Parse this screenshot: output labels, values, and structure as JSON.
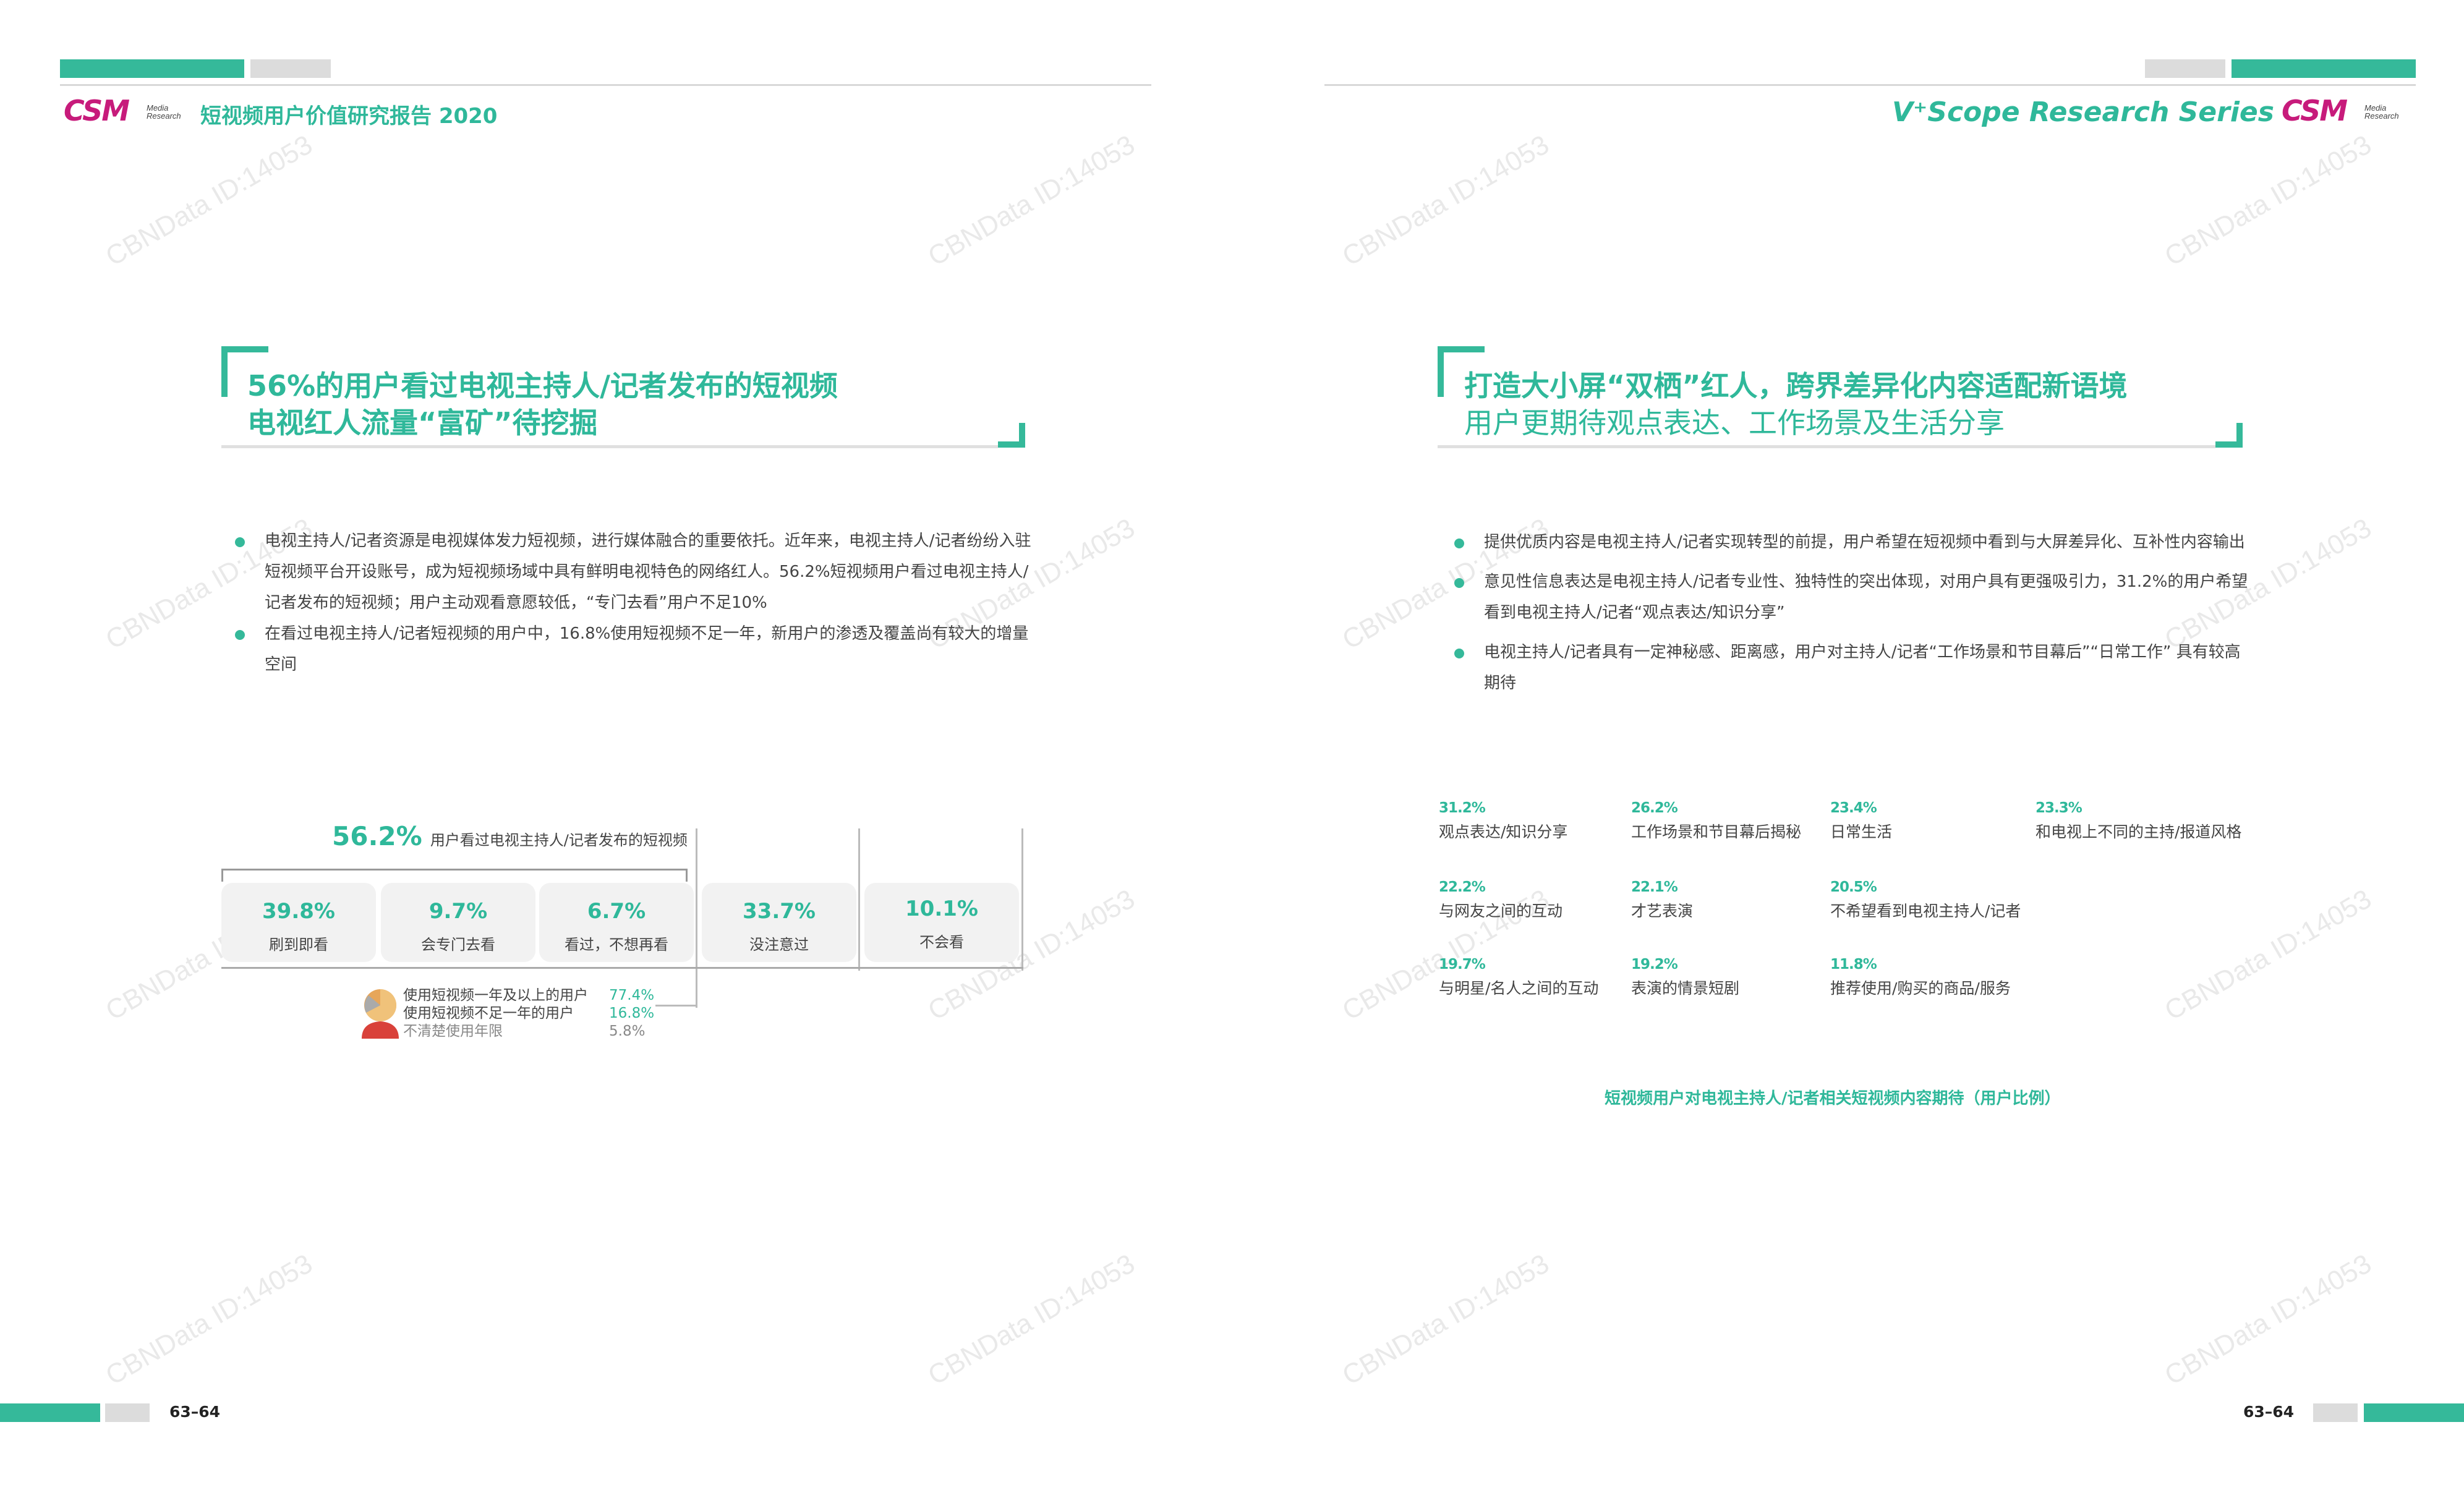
{
  "header": {
    "report_title": "短视频用户价值研究报告 2020",
    "brand": "CSM",
    "brand_sub_1": "Media",
    "brand_sub_2": "Research",
    "series_title": "V⁺Scope Research Series"
  },
  "watermark": "CBNData ID:14053",
  "left": {
    "title_line1": "56%的用户看过电视主持人/记者发布的短视频",
    "title_line2": "电视红人流量“富矿”待挖掘",
    "bullets": [
      "电视主持人/记者资源是电视媒体发力短视频，进行媒体融合的重要依托。近年来，电视主持人/记者纷纷入驻短视频平台开设账号，成为短视频场域中具有鲜明电视特色的网络红人。56.2%短视频用户看过电视主持人/记者发布的短视频；用户主动观看意愿较低，“专门去看”用户不足10%",
      "在看过电视主持人/记者短视频的用户中，16.8%使用短视频不足一年，新用户的渗透及覆盖尚有较大的增量空间"
    ],
    "watched_pct": "56.2%",
    "watched_label": "用户看过电视主持人/记者发布的短视频",
    "boxes": [
      {
        "value": "39.8%",
        "label": "刷到即看"
      },
      {
        "value": "9.7%",
        "label": "会专门去看"
      },
      {
        "value": "6.7%",
        "label": "看过，不想再看"
      },
      {
        "value": "33.7%",
        "label": "没注意过"
      },
      {
        "value": "10.1%",
        "label": "不会看"
      }
    ],
    "usage": [
      {
        "label": "使用短视频一年及以上的用户",
        "value": "77.4%"
      },
      {
        "label": "使用短视频不足一年的用户",
        "value": "16.8%"
      },
      {
        "label": "不清楚使用年限",
        "value": "5.8%"
      }
    ],
    "page_number": "63–64"
  },
  "right": {
    "title_line1": "打造大小屏“双栖”红人，跨界差异化内容适配新语境",
    "title_line2": "用户更期待观点表达、工作场景及生活分享",
    "bullets": [
      "提供优质内容是电视主持人/记者实现转型的前提，用户希望在短视频中看到与大屏差异化、互补性内容输出",
      "意见性信息表达是电视主持人/记者专业性、独特性的突出体现，对用户具有更强吸引力，31.2%的用户希望看到电视主持人/记者“观点表达/知识分享”",
      "电视主持人/记者具有一定神秘感、距离感，用户对主持人/记者“工作场景和节目幕后”“日常工作” 具有较高期待"
    ],
    "expectations": [
      {
        "pct": "31.2%",
        "label": "观点表达/知识分享"
      },
      {
        "pct": "26.2%",
        "label": "工作场景和节目幕后揭秘"
      },
      {
        "pct": "23.4%",
        "label": "日常生活"
      },
      {
        "pct": "23.3%",
        "label": "和电视上不同的主持/报道风格"
      },
      {
        "pct": "22.2%",
        "label": "与网友之间的互动"
      },
      {
        "pct": "22.1%",
        "label": "才艺表演"
      },
      {
        "pct": "20.5%",
        "label": "不希望看到电视主持人/记者"
      },
      {
        "pct": "19.7%",
        "label": "与明星/名人之间的互动"
      },
      {
        "pct": "19.2%",
        "label": "表演的情景短剧"
      },
      {
        "pct": "11.8%",
        "label": "推荐使用/购买的商品/服务"
      }
    ],
    "caption": "短视频用户对电视主持人/记者相关短视频内容期待（用户比例）",
    "page_number": "63–64"
  },
  "colors": {
    "accent": "#35b99a",
    "brand": "#c71b7b",
    "gray": "#dcdcdc"
  }
}
